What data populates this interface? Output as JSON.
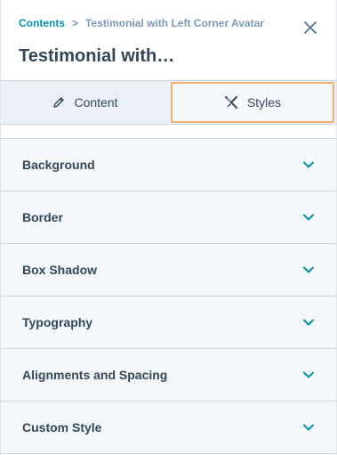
{
  "breadcrumb": {
    "parent": "Contents",
    "separator": ">",
    "current": "Testimonial with Left Corner Avatar"
  },
  "title": "Testimonial with…",
  "tabs": [
    {
      "label": "Content",
      "icon": "pencil-icon",
      "active": false
    },
    {
      "label": "Styles",
      "icon": "brush-ruler-icon",
      "active": true
    }
  ],
  "sections": [
    {
      "label": "Background"
    },
    {
      "label": "Border"
    },
    {
      "label": "Box Shadow"
    },
    {
      "label": "Typography"
    },
    {
      "label": "Alignments and Spacing"
    },
    {
      "label": "Custom Style"
    }
  ],
  "colors": {
    "accent": "#0091ae",
    "focus_outline": "#f2b06a",
    "text": "#33475b",
    "muted": "#7c98b6"
  }
}
